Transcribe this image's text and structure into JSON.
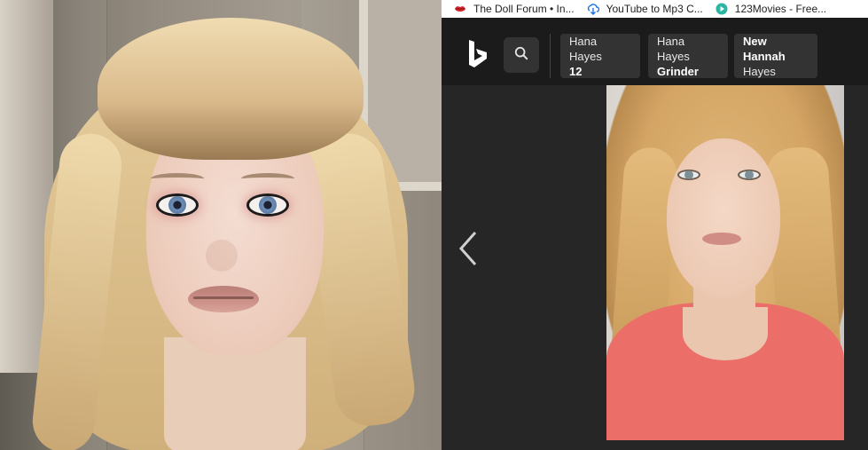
{
  "bookmarks": [
    {
      "label": "The Doll Forum • In...",
      "icon": "lips-icon",
      "color": "#d9262b"
    },
    {
      "label": "YouTube to Mp3 C...",
      "icon": "download-cloud-icon",
      "color": "#1a73e8"
    },
    {
      "label": "123Movies - Free...",
      "icon": "play-circle-icon",
      "color": "#2bb6a3"
    }
  ],
  "header": {
    "logo": "bing-logo",
    "search_icon": "search-icon"
  },
  "related_searches": [
    {
      "line1": "Hana Hayes",
      "line2": "12"
    },
    {
      "line1": "Hana Hayes",
      "line2": "Grinder"
    },
    {
      "line1": "New Hannah",
      "line2": "Hayes"
    }
  ],
  "viewer": {
    "prev_icon": "chevron-left-icon"
  },
  "colors": {
    "header_bg": "#1b1b1b",
    "chip_bg": "#333333",
    "page_bg": "#262626",
    "shirt": "#ec6e68"
  }
}
